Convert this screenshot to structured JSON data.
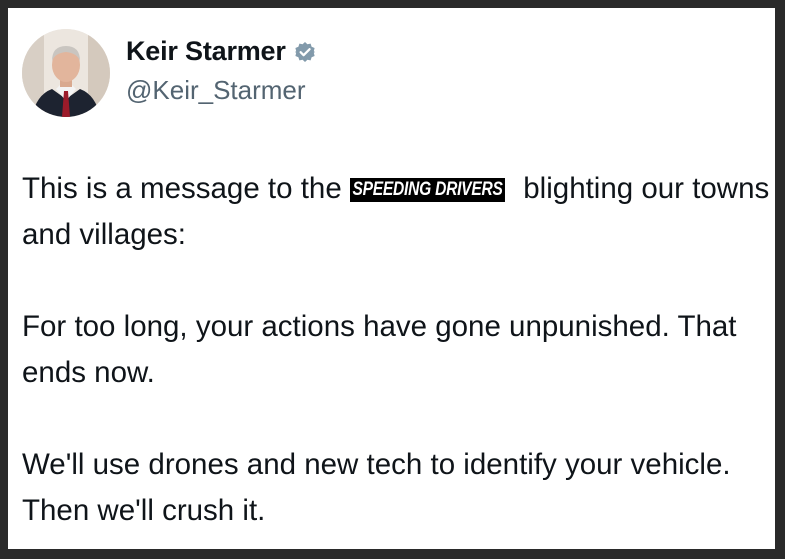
{
  "author": {
    "display_name": "Keir Starmer",
    "handle": "@Keir_Starmer",
    "verified": true,
    "verified_icon": "verified-badge-icon",
    "avatar_icon": "profile-photo"
  },
  "tweet": {
    "line1_before": "This is a message to the ",
    "highlight": "SPEEDING DRIVERS",
    "line1_after": " blighting our towns and villages:",
    "para2": "For too long, your actions have gone unpunished. That ends now.",
    "para3": "We'll use drones and new tech to identify your vehicle. Then we'll crush it."
  },
  "colors": {
    "text": "#0f1419",
    "handle": "#536471",
    "badge": "#829aab",
    "frame": "#2a2a2a"
  }
}
